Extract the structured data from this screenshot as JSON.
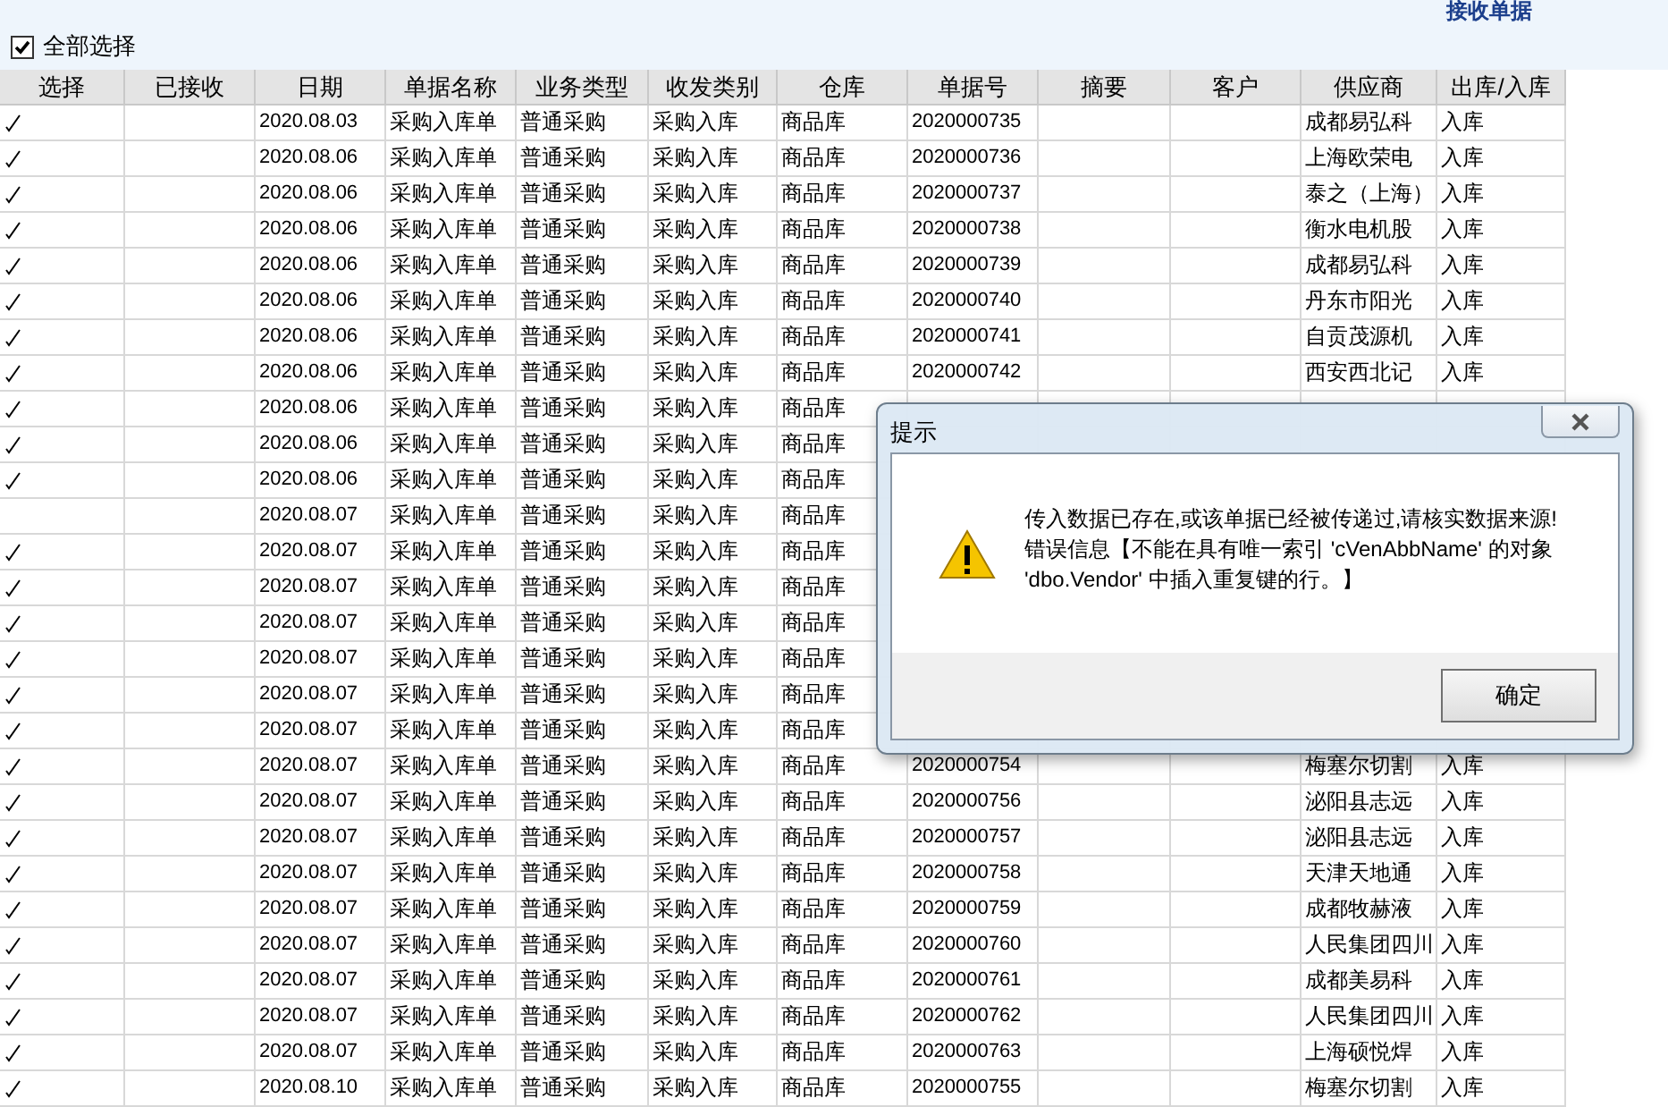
{
  "title": "接收单据",
  "select_all": {
    "label": "全部选择",
    "checked": true
  },
  "table": {
    "columns": [
      "选择",
      "已接收",
      "日期",
      "单据名称",
      "业务类型",
      "收发类别",
      "仓库",
      "单据号",
      "摘要",
      "客户",
      "供应商",
      "出库/入库"
    ],
    "rows": [
      {
        "checked": true,
        "date": "2020.08.03",
        "doc_name": "采购入库单",
        "biz_type": "普通采购",
        "io_type": "采购入库",
        "warehouse": "商品库",
        "doc_no": "2020000735",
        "supplier": "成都易弘科",
        "direction": "入库"
      },
      {
        "checked": true,
        "date": "2020.08.06",
        "doc_name": "采购入库单",
        "biz_type": "普通采购",
        "io_type": "采购入库",
        "warehouse": "商品库",
        "doc_no": "2020000736",
        "supplier": "上海欧荣电",
        "direction": "入库"
      },
      {
        "checked": true,
        "date": "2020.08.06",
        "doc_name": "采购入库单",
        "biz_type": "普通采购",
        "io_type": "采购入库",
        "warehouse": "商品库",
        "doc_no": "2020000737",
        "supplier": "泰之（上海）",
        "direction": "入库"
      },
      {
        "checked": true,
        "date": "2020.08.06",
        "doc_name": "采购入库单",
        "biz_type": "普通采购",
        "io_type": "采购入库",
        "warehouse": "商品库",
        "doc_no": "2020000738",
        "supplier": "衡水电机股",
        "direction": "入库"
      },
      {
        "checked": true,
        "date": "2020.08.06",
        "doc_name": "采购入库单",
        "biz_type": "普通采购",
        "io_type": "采购入库",
        "warehouse": "商品库",
        "doc_no": "2020000739",
        "supplier": "成都易弘科",
        "direction": "入库"
      },
      {
        "checked": true,
        "date": "2020.08.06",
        "doc_name": "采购入库单",
        "biz_type": "普通采购",
        "io_type": "采购入库",
        "warehouse": "商品库",
        "doc_no": "2020000740",
        "supplier": "丹东市阳光",
        "direction": "入库"
      },
      {
        "checked": true,
        "date": "2020.08.06",
        "doc_name": "采购入库单",
        "biz_type": "普通采购",
        "io_type": "采购入库",
        "warehouse": "商品库",
        "doc_no": "2020000741",
        "supplier": "自贡茂源机",
        "direction": "入库"
      },
      {
        "checked": true,
        "date": "2020.08.06",
        "doc_name": "采购入库单",
        "biz_type": "普通采购",
        "io_type": "采购入库",
        "warehouse": "商品库",
        "doc_no": "2020000742",
        "supplier": "西安西北记",
        "direction": "入库"
      },
      {
        "checked": true,
        "date": "2020.08.06",
        "doc_name": "采购入库单",
        "biz_type": "普通采购",
        "io_type": "采购入库",
        "warehouse": "商品库"
      },
      {
        "checked": true,
        "date": "2020.08.06",
        "doc_name": "采购入库单",
        "biz_type": "普通采购",
        "io_type": "采购入库",
        "warehouse": "商品库"
      },
      {
        "checked": true,
        "date": "2020.08.06",
        "doc_name": "采购入库单",
        "biz_type": "普通采购",
        "io_type": "采购入库",
        "warehouse": "商品库"
      },
      {
        "checked": false,
        "date": "2020.08.07",
        "doc_name": "采购入库单",
        "biz_type": "普通采购",
        "io_type": "采购入库",
        "warehouse": "商品库"
      },
      {
        "checked": true,
        "date": "2020.08.07",
        "doc_name": "采购入库单",
        "biz_type": "普通采购",
        "io_type": "采购入库",
        "warehouse": "商品库"
      },
      {
        "checked": true,
        "date": "2020.08.07",
        "doc_name": "采购入库单",
        "biz_type": "普通采购",
        "io_type": "采购入库",
        "warehouse": "商品库"
      },
      {
        "checked": true,
        "date": "2020.08.07",
        "doc_name": "采购入库单",
        "biz_type": "普通采购",
        "io_type": "采购入库",
        "warehouse": "商品库"
      },
      {
        "checked": true,
        "date": "2020.08.07",
        "doc_name": "采购入库单",
        "biz_type": "普通采购",
        "io_type": "采购入库",
        "warehouse": "商品库"
      },
      {
        "checked": true,
        "date": "2020.08.07",
        "doc_name": "采购入库单",
        "biz_type": "普通采购",
        "io_type": "采购入库",
        "warehouse": "商品库"
      },
      {
        "checked": true,
        "date": "2020.08.07",
        "doc_name": "采购入库单",
        "biz_type": "普通采购",
        "io_type": "采购入库",
        "warehouse": "商品库"
      },
      {
        "checked": true,
        "date": "2020.08.07",
        "doc_name": "采购入库单",
        "biz_type": "普通采购",
        "io_type": "采购入库",
        "warehouse": "商品库",
        "doc_no": "2020000754",
        "supplier": "梅塞尔切割",
        "direction": "入库"
      },
      {
        "checked": true,
        "date": "2020.08.07",
        "doc_name": "采购入库单",
        "biz_type": "普通采购",
        "io_type": "采购入库",
        "warehouse": "商品库",
        "doc_no": "2020000756",
        "supplier": "泌阳县志远",
        "direction": "入库"
      },
      {
        "checked": true,
        "date": "2020.08.07",
        "doc_name": "采购入库单",
        "biz_type": "普通采购",
        "io_type": "采购入库",
        "warehouse": "商品库",
        "doc_no": "2020000757",
        "supplier": "泌阳县志远",
        "direction": "入库"
      },
      {
        "checked": true,
        "date": "2020.08.07",
        "doc_name": "采购入库单",
        "biz_type": "普通采购",
        "io_type": "采购入库",
        "warehouse": "商品库",
        "doc_no": "2020000758",
        "supplier": "天津天地通",
        "direction": "入库"
      },
      {
        "checked": true,
        "date": "2020.08.07",
        "doc_name": "采购入库单",
        "biz_type": "普通采购",
        "io_type": "采购入库",
        "warehouse": "商品库",
        "doc_no": "2020000759",
        "supplier": "成都牧赫液",
        "direction": "入库"
      },
      {
        "checked": true,
        "date": "2020.08.07",
        "doc_name": "采购入库单",
        "biz_type": "普通采购",
        "io_type": "采购入库",
        "warehouse": "商品库",
        "doc_no": "2020000760",
        "supplier": "人民集团四川",
        "direction": "入库"
      },
      {
        "checked": true,
        "date": "2020.08.07",
        "doc_name": "采购入库单",
        "biz_type": "普通采购",
        "io_type": "采购入库",
        "warehouse": "商品库",
        "doc_no": "2020000761",
        "supplier": "成都美易科",
        "direction": "入库"
      },
      {
        "checked": true,
        "date": "2020.08.07",
        "doc_name": "采购入库单",
        "biz_type": "普通采购",
        "io_type": "采购入库",
        "warehouse": "商品库",
        "doc_no": "2020000762",
        "supplier": "人民集团四川",
        "direction": "入库"
      },
      {
        "checked": true,
        "date": "2020.08.07",
        "doc_name": "采购入库单",
        "biz_type": "普通采购",
        "io_type": "采购入库",
        "warehouse": "商品库",
        "doc_no": "2020000763",
        "supplier": "上海硕悦焊",
        "direction": "入库"
      },
      {
        "checked": true,
        "date": "2020.08.10",
        "doc_name": "采购入库单",
        "biz_type": "普通采购",
        "io_type": "采购入库",
        "warehouse": "商品库",
        "doc_no": "2020000755",
        "supplier": "梅塞尔切割",
        "direction": "入库"
      }
    ]
  },
  "dialog": {
    "title": "提示",
    "message_lines": [
      "传入数据已存在,或该单据已经被传递过,请核实数据来源!",
      "错误信息【不能在具有唯一索引 'cVenAbbName' 的对象",
      "'dbo.Vendor' 中插入重复键的行。】"
    ],
    "ok_button": "确定"
  }
}
